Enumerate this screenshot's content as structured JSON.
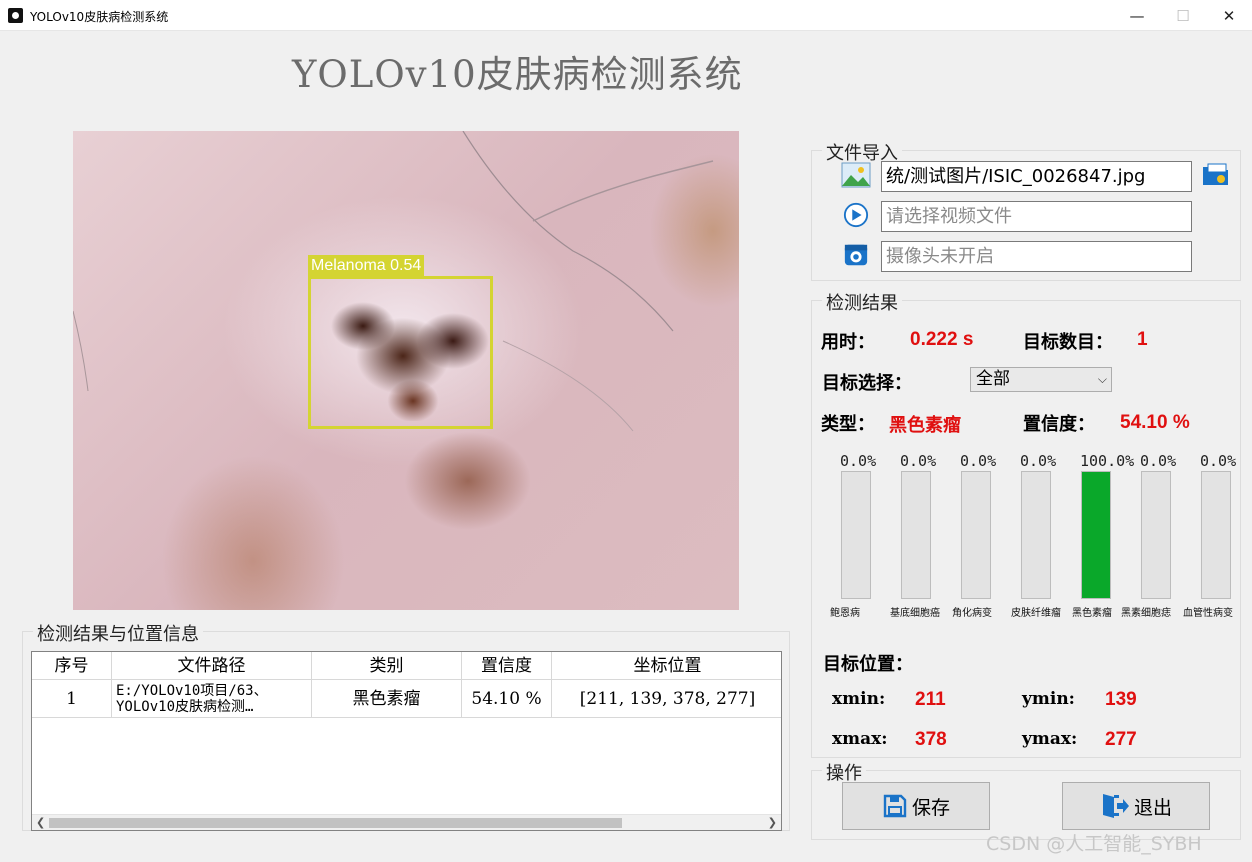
{
  "window": {
    "title": "YOLOv10皮肤病检测系统",
    "min": "—",
    "max": "☐",
    "close": "✕"
  },
  "header": {
    "title": "YOLOv10皮肤病检测系统"
  },
  "detection_image": {
    "label": "Melanoma 0.54"
  },
  "file_import": {
    "title": "文件导入",
    "image_path": "统/测试图片/ISIC_0026847.jpg",
    "video_placeholder": "请选择视频文件",
    "camera_placeholder": "摄像头未开启"
  },
  "results": {
    "title": "检测结果",
    "time_label": "用时：",
    "time_value": "0.222 s",
    "count_label": "目标数目：",
    "count_value": "1",
    "select_label": "目标选择：",
    "select_value": "全部",
    "type_label": "类型：",
    "type_value": "黑色素瘤",
    "conf_label": "置信度：",
    "conf_value": "54.10 %",
    "bars": [
      {
        "name": "鲍恩病",
        "pct": "0.0%",
        "value": 0
      },
      {
        "name": "基底细胞癌",
        "pct": "0.0%",
        "value": 0
      },
      {
        "name": "角化病变",
        "pct": "0.0%",
        "value": 0
      },
      {
        "name": "皮肤纤维瘤",
        "pct": "0.0%",
        "value": 0
      },
      {
        "name": "黑色素瘤",
        "pct": "100.0%",
        "value": 1.0
      },
      {
        "name": "黑素细胞痣",
        "pct": "0.0%",
        "value": 0
      },
      {
        "name": "血管性病变",
        "pct": "0.0%",
        "value": 0
      }
    ],
    "position_label": "目标位置：",
    "xmin_label": "xmin:",
    "xmin": "211",
    "ymin_label": "ymin:",
    "ymin": "139",
    "xmax_label": "xmax:",
    "xmax": "378",
    "ymax_label": "ymax:",
    "ymax": "277"
  },
  "operations": {
    "title": "操作",
    "save": "保存",
    "exit": "退出"
  },
  "table": {
    "title": "检测结果与位置信息",
    "headers": [
      "序号",
      "文件路径",
      "类别",
      "置信度",
      "坐标位置"
    ],
    "rows": [
      {
        "index": "1",
        "path_line1": "E:/YOLOv10项目/63、",
        "path_line2": "YOLOv10皮肤病检测…",
        "class": "黑色素瘤",
        "conf": "54.10 %",
        "coords": "[211, 139, 378, 277]"
      }
    ]
  },
  "watermark": "CSDN @人工智能_SYBH",
  "colors": {
    "accent_red": "#e01010",
    "bar_fill": "#0aa82a",
    "box_yellow": "#d4d432",
    "icon_blue": "#1a73c8"
  }
}
